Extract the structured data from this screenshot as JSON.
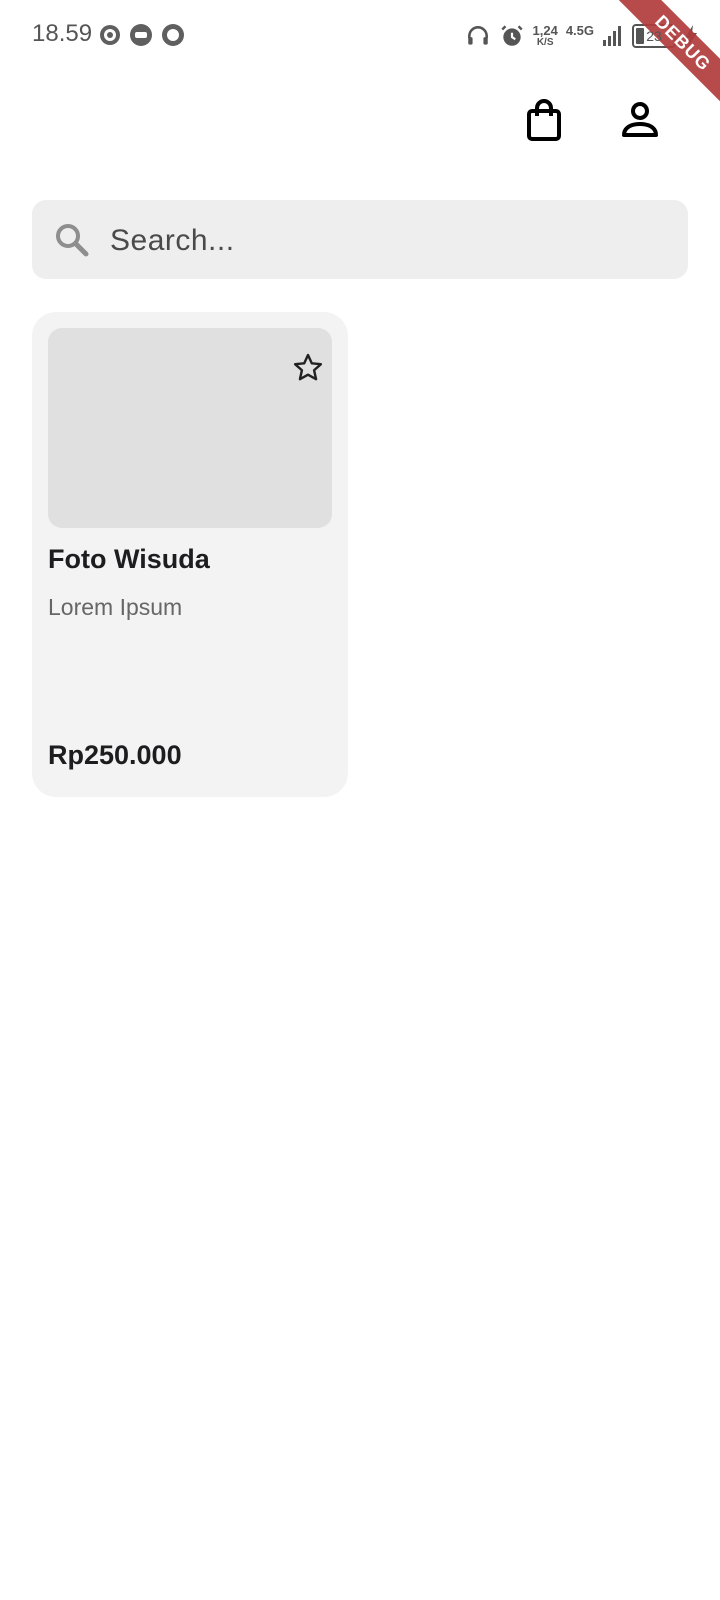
{
  "status_bar": {
    "time": "18.59",
    "net_speed": "1,24",
    "net_speed_unit": "K/S",
    "network_type": "4.5G",
    "battery_level": "23"
  },
  "debug_banner": "DEBUG",
  "app_bar": {
    "cart_icon": "shopping-bag-icon",
    "profile_icon": "person-icon"
  },
  "search": {
    "placeholder": "Search...",
    "value": ""
  },
  "products": [
    {
      "title": "Foto Wisuda",
      "subtitle": "Lorem Ipsum",
      "price": "Rp250.000",
      "favorite": false
    }
  ],
  "colors": {
    "background": "#ffffff",
    "search_bg": "#eeeeee",
    "card_bg": "#f3f3f3",
    "image_placeholder": "#e0e0e0",
    "debug_banner": "#b13c3c"
  }
}
